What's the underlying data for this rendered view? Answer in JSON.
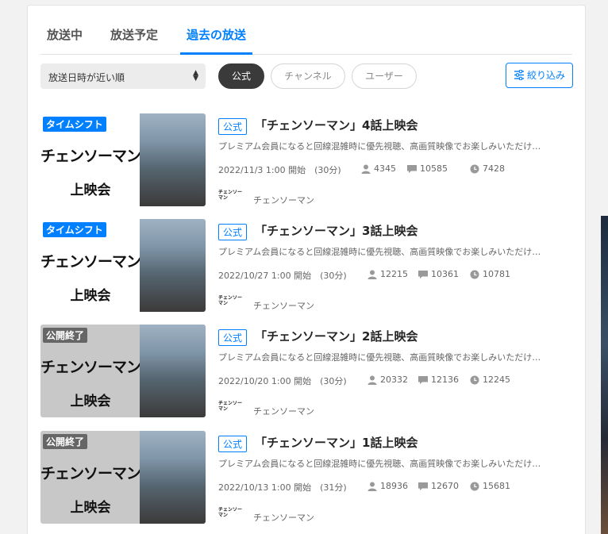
{
  "tabs": [
    {
      "label": "放送中"
    },
    {
      "label": "放送予定"
    },
    {
      "label": "過去の放送"
    }
  ],
  "sort": {
    "label": "放送日時が近い順"
  },
  "pills": [
    {
      "label": "公式"
    },
    {
      "label": "チャンネル"
    },
    {
      "label": "ユーザー"
    }
  ],
  "filter": {
    "label": "絞り込み"
  },
  "colors": {
    "accent": "#0080ff",
    "timeshift_badge": "#0080ff",
    "ended_badge": "#666666"
  },
  "items": [
    {
      "badge": "タイムシフト",
      "badge_type": "timeshift",
      "thumb_title": "チェンソーマン",
      "thumb_sub": "上映会",
      "official": "公式",
      "title": "「チェンソーマン」4話上映会",
      "desc": "プレミアム会員になると回線混雑時に優先視聴、高画質映像でお楽しみいただけ…",
      "date": "2022/11/3 1:00 開始　(30分)",
      "viewers": "4345",
      "comments": "10585",
      "timeshift": "7428",
      "logo": "チェンソーマン",
      "channel": "チェンソーマン"
    },
    {
      "badge": "タイムシフト",
      "badge_type": "timeshift",
      "thumb_title": "チェンソーマン",
      "thumb_sub": "上映会",
      "official": "公式",
      "title": "「チェンソーマン」3話上映会",
      "desc": "プレミアム会員になると回線混雑時に優先視聴、高画質映像でお楽しみいただけ…",
      "date": "2022/10/27 1:00 開始　(30分)",
      "viewers": "12215",
      "comments": "10361",
      "timeshift": "10781",
      "logo": "チェンソーマン",
      "channel": "チェンソーマン"
    },
    {
      "badge": "公開終了",
      "badge_type": "ended",
      "thumb_title": "チェンソーマン",
      "thumb_sub": "上映会",
      "official": "公式",
      "title": "「チェンソーマン」2話上映会",
      "desc": "プレミアム会員になると回線混雑時に優先視聴、高画質映像でお楽しみいただけ…",
      "date": "2022/10/20 1:00 開始　(30分)",
      "viewers": "20332",
      "comments": "12136",
      "timeshift": "12245",
      "logo": "チェンソーマン",
      "channel": "チェンソーマン"
    },
    {
      "badge": "公開終了",
      "badge_type": "ended",
      "thumb_title": "チェンソーマン",
      "thumb_sub": "上映会",
      "official": "公式",
      "title": "「チェンソーマン」1話上映会",
      "desc": "プレミアム会員になると回線混雑時に優先視聴、高画質映像でお楽しみいただけ…",
      "date": "2022/10/13 1:00 開始　(31分)",
      "viewers": "18936",
      "comments": "12670",
      "timeshift": "15681",
      "logo": "チェンソーマン",
      "channel": "チェンソーマン"
    }
  ]
}
